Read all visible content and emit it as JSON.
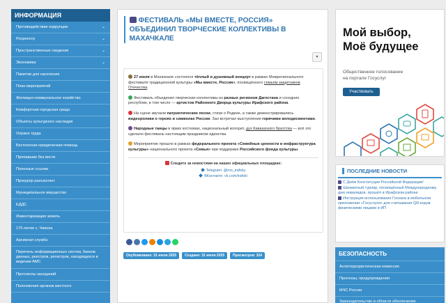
{
  "sidebar": {
    "heading": "ИНФОРМАЦИЯ",
    "items": [
      {
        "label": "Противодействие коррупции",
        "chevron": true
      },
      {
        "label": "Росреестр",
        "chevron": true
      },
      {
        "label": "Пространственные сведения",
        "chevron": true
      },
      {
        "label": "Экономика",
        "chevron": true
      },
      {
        "label": "Памятки для населения",
        "chevron": false
      },
      {
        "label": "План мероприятий",
        "chevron": false
      },
      {
        "label": "Жилищно-коммунальное хозяйство",
        "chevron": false
      },
      {
        "label": "Комфортная городская среда",
        "chevron": false
      },
      {
        "label": "Объекты культурного наследия",
        "chevron": false
      },
      {
        "label": "Охрана труда",
        "chevron": false
      },
      {
        "label": "Бесплатная юридическая помощь",
        "chevron": false
      },
      {
        "label": "Пропавшие без вести",
        "chevron": false
      },
      {
        "label": "Полезные ссылки",
        "chevron": false
      },
      {
        "label": "Прокурор разъясняет",
        "chevron": false
      },
      {
        "label": "Муниципальное имущество",
        "chevron": false
      },
      {
        "label": "ЕДДС",
        "chevron": false
      },
      {
        "label": "Инвентаризация земель",
        "chevron": false
      },
      {
        "label": "170-летие с. Чикола",
        "chevron": false
      },
      {
        "label": "Архивная служба",
        "chevron": false
      },
      {
        "label": "Перечень информационных систем, банков данных, реестров, регистров, находящихся в ведении АМС",
        "chevron": false
      },
      {
        "label": "Протоколы заседаний",
        "chevron": false
      },
      {
        "label": "Полномочия органов местного",
        "chevron": false
      }
    ]
  },
  "article": {
    "title": "ФЕСТИВАЛЬ «МЫ ВМЕСТЕ, РОССИЯ» ОБЪЕДИНИЛ ТВОРЧЕСКИЕ КОЛЛЕКТИВЫ В МАХАЧКАЛЕ",
    "p1": {
      "date": "27 июля",
      "text1": " в Махачкале состоялся ",
      "bold1": "тёплый и душевный концерт",
      "text2": " в рамках Межрегионального фестиваля традиционной культуры ",
      "bold2": "«Мы вместе, Россия»",
      "text3": ", посвящённого ",
      "link": "семьям защитников Отечества",
      "text4": "."
    },
    "p2": {
      "text1": "Фестиваль объединил творческие коллективы из ",
      "bold1": "разных регионов Дагестана",
      "text2": " и соседних республик, в том числе — ",
      "bold2": "артистов Районного Дворца культуры Ирафского района",
      "text3": "."
    },
    "p3": {
      "text1": "На сцене звучали ",
      "bold1": "патриотические песни",
      "text2": ", стихи о Родине, а также демонстрировались ",
      "bold2": "видеоролики о героях и символах России",
      "text3": ". Зал встречал выступления ",
      "bold3": "горячими аплодисментами",
      "text4": "."
    },
    "p4": {
      "bold1": "Народные танцы",
      "text1": " в ярких костюмах, национальный колорит, ",
      "link": "дух Кавказского братства",
      "text2": " — всё это сделало фестиваль настоящим праздником единства."
    },
    "p5": {
      "text1": "Мероприятие прошло в рамках ",
      "bold1": "федерального проекта «Семейные ценности и инфраструктура культуры»",
      "text2": " национального проекта ",
      "bold2": "«Семья»",
      "text3": " при поддержке ",
      "bold3": "Российского фонда культуры",
      "text4": "."
    },
    "follow": "Следите за новостями на наших официальных площадках:",
    "telegram": "Telegram: @mo_irafsky",
    "vk": "ВКонтакте: vk.com/irafski",
    "badges": {
      "published": "Опубликовано: 31 июля 2025",
      "created": "Создано: 31 июля 2025",
      "views": "Просмотров: 324"
    }
  },
  "banner": {
    "headline1": "Мой выбор,",
    "headline2": "Моё будущее",
    "sub1": "Общественное голосование",
    "sub2": "на портале Госуслуг",
    "button": "Участвовать"
  },
  "news": {
    "heading": "ПОСЛЕДНИЕ НОВОСТИ",
    "items": [
      "С Днём Конституции Российской Федерации!",
      "Шахматный турнир, посвящённый Международному дню инвалидов, прошёл в Ирафском районе",
      "Инструкция использования Госкана в мобильном приложении «Госуслуги» для считывания QR-кодов физическими лицами и ИП"
    ]
  },
  "security": {
    "heading": "БЕЗОПАСНОСТЬ",
    "items": [
      "Антитеррористическая комиссия",
      "Прогнозы, предупреждения",
      "МЧС России",
      "Законодательство в области обеспечения безопасности"
    ]
  },
  "colors": {
    "sidebar": "#3a8fca",
    "sidebar_head": "#1e5f91",
    "title": "#2f75b0"
  }
}
